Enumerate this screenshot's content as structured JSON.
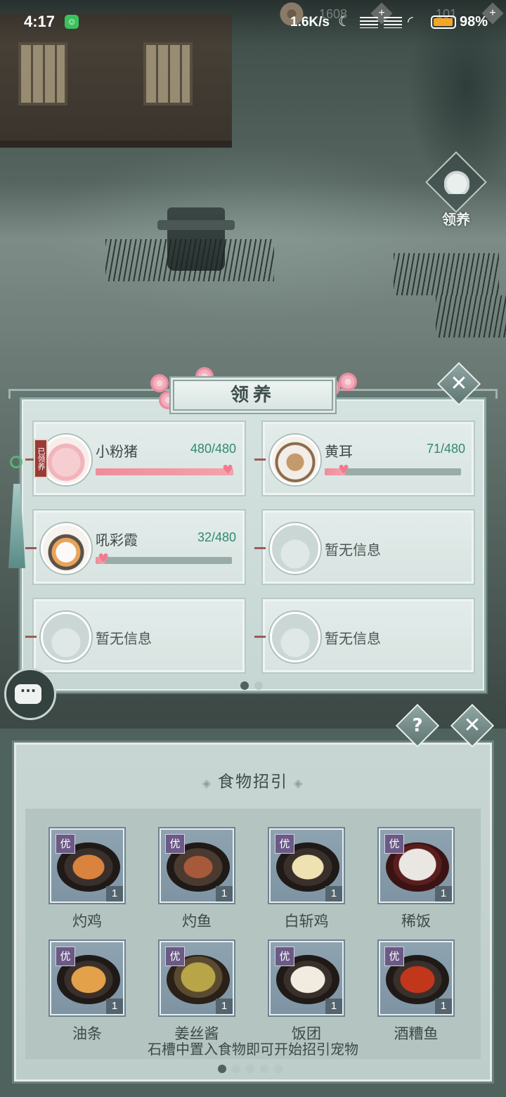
{
  "status_bar": {
    "time": "4:17",
    "network_speed": "1.6K/s",
    "battery_percent": "98%"
  },
  "hud": {
    "currency_1": "1608",
    "currency_2": "101",
    "plus": "+"
  },
  "side_button": {
    "label": "领养"
  },
  "adopt_panel": {
    "title": "领养",
    "close": "✕",
    "adopted_tag": "已领养",
    "pets": [
      {
        "name": "小粉猪",
        "count": "480/480",
        "progress": 1.0,
        "avatar": "pig-avatar"
      },
      {
        "name": "黄耳",
        "count": "71/480",
        "progress": 0.148,
        "avatar": "dog-avatar"
      },
      {
        "name": "吼彩霞",
        "count": "32/480",
        "progress": 0.067,
        "avatar": "cat-avatar"
      },
      {
        "name": "暂无信息",
        "empty": true
      },
      {
        "name": "暂无信息",
        "empty": true
      },
      {
        "name": "暂无信息",
        "empty": true
      }
    ],
    "page_dots": 2,
    "active_page": 0
  },
  "food_panel": {
    "help": "?",
    "close": "✕",
    "title": "食物招引",
    "badge": "优",
    "foods": [
      {
        "name": "灼鸡",
        "qty": "1"
      },
      {
        "name": "灼鱼",
        "qty": "1"
      },
      {
        "name": "白斩鸡",
        "qty": "1"
      },
      {
        "name": "稀饭",
        "qty": "1"
      },
      {
        "name": "油条",
        "qty": "1"
      },
      {
        "name": "姜丝酱",
        "qty": "1"
      },
      {
        "name": "饭团",
        "qty": "1"
      },
      {
        "name": "酒糟鱼",
        "qty": "1"
      }
    ],
    "hint": "石槽中置入食物即可开始招引宠物",
    "page_dots": 5,
    "active_page": 0
  }
}
